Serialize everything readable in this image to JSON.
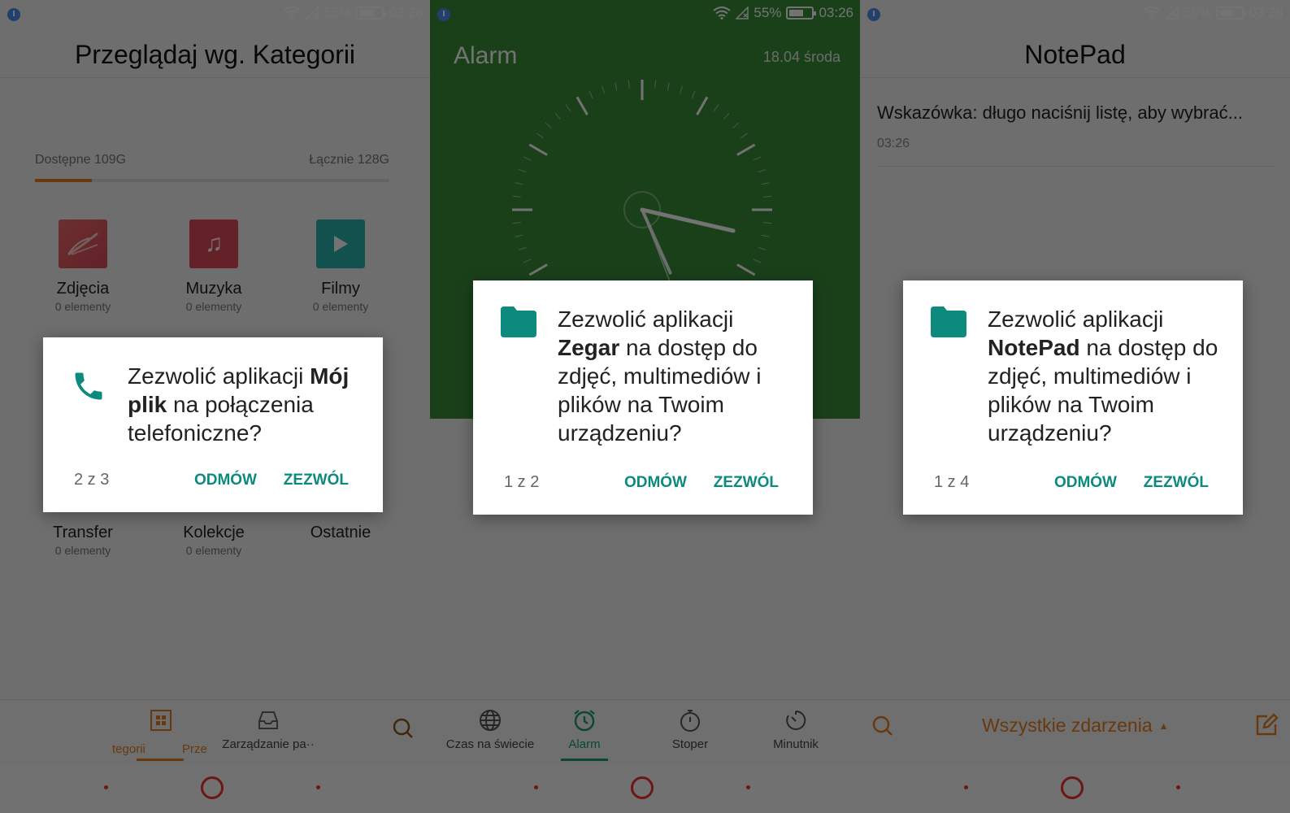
{
  "status": {
    "battery": "55%",
    "time": "03:26"
  },
  "s1": {
    "title": "Przeglądaj wg. Kategorii",
    "storage": {
      "available": "Dostępne 109G",
      "total": "Łącznie 128G",
      "used_fraction": 0.16
    },
    "categories": [
      {
        "name": "Zdjęcia",
        "count": "0 elementy"
      },
      {
        "name": "Muzyka",
        "count": "0 elementy"
      },
      {
        "name": "Filmy",
        "count": "0 elementy"
      },
      {
        "name": "Transfer",
        "count": "0 elementy"
      },
      {
        "name": "Kolekcje",
        "count": "0 elementy"
      },
      {
        "name": "Ostatnie",
        "count": ""
      }
    ],
    "nav": {
      "tab1": "tegorii",
      "tab2": "Prze",
      "tab3": "Zarządzanie pa··"
    },
    "dialog": {
      "pre": "Zezwolić aplikacji ",
      "app": "Mój plik",
      "post": " na połączenia telefoniczne?",
      "counter": "2 z 3",
      "deny": "ODMÓW",
      "allow": "ZEZWÓL"
    }
  },
  "s2": {
    "title": "Alarm",
    "date": "18.04  środa",
    "nav": {
      "world": "Czas na świecie",
      "alarm": "Alarm",
      "stopwatch": "Stoper",
      "timer": "Minutnik"
    },
    "dialog": {
      "pre": "Zezwolić aplikacji ",
      "app": "Zegar",
      "post": " na dostęp do zdjęć, multimediów i plików na Twoim urządzeniu?",
      "counter": "1 z 2",
      "deny": "ODMÓW",
      "allow": "ZEZWÓL"
    }
  },
  "s3": {
    "title": "NotePad",
    "note": {
      "text": "Wskazówka: długo naciśnij listę, aby wybrać...",
      "time": "03:26"
    },
    "filter": "Wszystkie zdarzenia",
    "dialog": {
      "pre": "Zezwolić aplikacji ",
      "app": "NotePad",
      "post": " na dostęp do zdjęć, multimediów i plików na Twoim urządzeniu?",
      "counter": "1 z 4",
      "deny": "ODMÓW",
      "allow": "ZEZWÓL"
    }
  },
  "colors": {
    "accent_teal": "#0d8a7e",
    "accent_orange": "#e67e22",
    "alarm_green": "#3a8f3a",
    "nav_red": "#e33333"
  }
}
